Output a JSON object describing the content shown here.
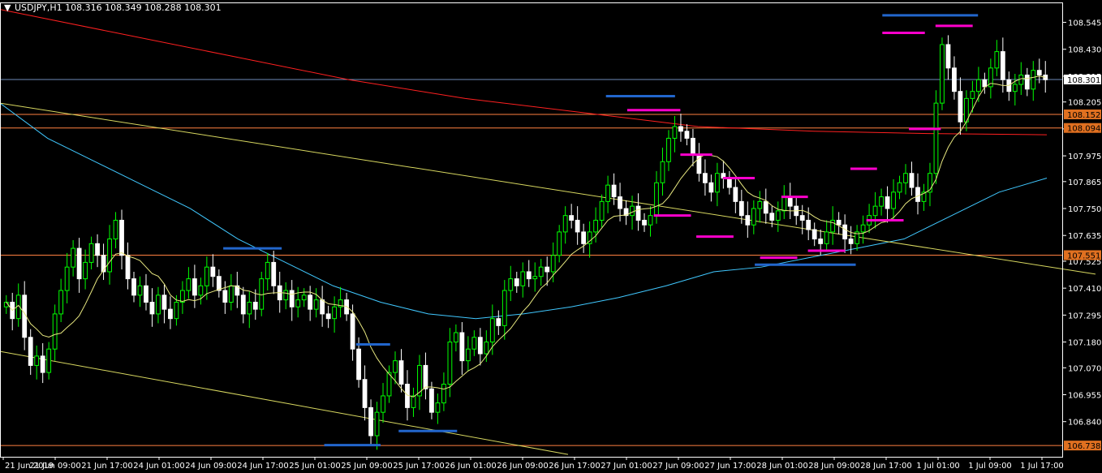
{
  "header": {
    "title": "USDJPY,H1  108.316 108.349 108.288 108.301",
    "menu_icon": "triangle-down-icon"
  },
  "colors": {
    "background": "#000000",
    "axis": "#ffffff",
    "bull": "#00ff00",
    "bear": "#ffffff",
    "ma_fast": "#e8e880",
    "ma_slow": "#40c8ff",
    "ma_long": "#ff2020",
    "trend": "#d8d860",
    "level": "#ff8040",
    "bid_line": "#6e8cb8",
    "resistance": "#ff00cc",
    "support": "#2266cc",
    "badge_orange": "#e07020"
  },
  "chart_data": {
    "type": "candlestick",
    "symbol": "USDJPY",
    "timeframe": "H1",
    "ohlc_summary": {
      "open": 108.316,
      "high": 108.349,
      "low": 108.288,
      "close": 108.301
    },
    "ylim": [
      106.69,
      108.63
    ],
    "y_ticks": [
      "108.545",
      "108.430",
      "108.315",
      "108.205",
      "108.090",
      "107.975",
      "107.865",
      "107.750",
      "107.635",
      "107.525",
      "107.410",
      "107.295",
      "107.180",
      "107.070",
      "106.955",
      "106.840"
    ],
    "x_ticks": [
      "21 Jun 2019",
      "21 Jun 09:00",
      "21 Jun 17:00",
      "24 Jun 01:00",
      "24 Jun 09:00",
      "24 Jun 17:00",
      "25 Jun 01:00",
      "25 Jun 09:00",
      "25 Jun 17:00",
      "26 Jun 01:00",
      "26 Jun 09:00",
      "26 Jun 17:00",
      "27 Jun 01:00",
      "27 Jun 09:00",
      "27 Jun 17:00",
      "28 Jun 01:00",
      "28 Jun 09:00",
      "28 Jun 17:00",
      "1 Jul 01:00",
      "1 Jul 09:00",
      "1 Jul 17:00"
    ],
    "price_badges": [
      {
        "value": 108.301,
        "label": "108.301",
        "style": "bid"
      },
      {
        "value": 108.152,
        "label": "108.152",
        "style": "level"
      },
      {
        "value": 108.094,
        "label": "108.094",
        "style": "level"
      },
      {
        "value": 107.551,
        "label": "107.551",
        "style": "level"
      },
      {
        "value": 106.738,
        "label": "106.738",
        "style": "level"
      }
    ],
    "horizontal_levels": [
      108.152,
      108.094,
      107.551,
      106.738
    ],
    "bid_line": 108.301,
    "closes": [
      107.35,
      107.28,
      107.38,
      107.2,
      107.08,
      107.12,
      107.05,
      107.15,
      107.3,
      107.4,
      107.5,
      107.58,
      107.45,
      107.52,
      107.6,
      107.55,
      107.48,
      107.62,
      107.7,
      107.55,
      107.45,
      107.38,
      107.42,
      107.35,
      107.3,
      107.38,
      107.32,
      107.28,
      107.35,
      107.4,
      107.45,
      107.38,
      107.42,
      107.5,
      107.46,
      107.4,
      107.35,
      107.42,
      107.38,
      107.3,
      107.35,
      107.32,
      107.45,
      107.52,
      107.42,
      107.36,
      107.4,
      107.33,
      107.36,
      107.38,
      107.32,
      107.36,
      107.3,
      107.28,
      107.33,
      107.36,
      107.3,
      107.15,
      107.02,
      106.9,
      106.78,
      106.88,
      106.95,
      107.05,
      107.1,
      107.0,
      106.9,
      106.95,
      107.08,
      106.98,
      106.88,
      106.92,
      107.0,
      107.18,
      107.22,
      107.1,
      107.15,
      107.2,
      107.13,
      107.18,
      107.28,
      107.25,
      107.4,
      107.45,
      107.42,
      107.48,
      107.45,
      107.46,
      107.5,
      107.48,
      107.55,
      107.65,
      107.72,
      107.7,
      107.65,
      107.6,
      107.65,
      107.7,
      107.78,
      107.85,
      107.8,
      107.75,
      107.72,
      107.76,
      107.7,
      107.68,
      107.72,
      107.86,
      107.95,
      108.05,
      108.1,
      108.08,
      108.05,
      107.98,
      107.9,
      107.86,
      107.82,
      107.9,
      107.88,
      107.84,
      107.78,
      107.72,
      107.68,
      107.75,
      107.78,
      107.73,
      107.7,
      107.74,
      107.8,
      107.76,
      107.72,
      107.7,
      107.66,
      107.62,
      107.6,
      107.65,
      107.7,
      107.68,
      107.62,
      107.6,
      107.65,
      107.68,
      107.72,
      107.76,
      107.8,
      107.75,
      107.82,
      107.86,
      107.9,
      107.84,
      107.78,
      107.82,
      107.9,
      108.2,
      108.45,
      108.35,
      108.25,
      108.12,
      108.22,
      108.25,
      108.3,
      108.27,
      108.35,
      108.42,
      108.3,
      108.25,
      108.28,
      108.32,
      108.26,
      108.34,
      108.32,
      108.3
    ],
    "ma_fast_points": [
      [
        107.52,
        107.45,
        107.32,
        107.32,
        107.38,
        107.42,
        107.44,
        107.44,
        107.42,
        107.43,
        107.42,
        107.4,
        107.28,
        107.08,
        107.02,
        107.08,
        107.18,
        107.38,
        107.58,
        107.72,
        107.78,
        107.86,
        107.88,
        107.82,
        107.8,
        107.74,
        107.7,
        107.72,
        107.78,
        107.98,
        108.1,
        108.26
      ]
    ],
    "ma_slow_points": [
      108.2,
      108.05,
      107.95,
      107.85,
      107.75,
      107.62,
      107.52,
      107.42,
      107.35,
      107.3,
      107.28,
      107.3,
      107.33,
      107.37,
      107.42,
      107.48,
      107.5,
      107.54,
      107.58,
      107.62,
      107.72,
      107.82,
      107.88
    ],
    "ma_long_points": [
      108.6,
      108.5,
      108.4,
      108.3,
      108.22,
      108.16,
      108.1,
      108.08,
      108.07,
      108.065
    ],
    "trend_upper": [
      [
        108.2
      ],
      [
        107.47
      ]
    ],
    "trend_lower": [
      [
        107.14
      ],
      [
        106.7
      ]
    ],
    "resistance_marks": [
      {
        "value": 108.17,
        "x_from": 0.59,
        "x_to": 0.64
      },
      {
        "value": 107.98,
        "x_from": 0.64,
        "x_to": 0.67
      },
      {
        "value": 107.88,
        "x_from": 0.68,
        "x_to": 0.71
      },
      {
        "value": 107.8,
        "x_from": 0.735,
        "x_to": 0.76
      },
      {
        "value": 107.92,
        "x_from": 0.8,
        "x_to": 0.825
      },
      {
        "value": 107.7,
        "x_from": 0.815,
        "x_to": 0.85
      },
      {
        "value": 108.5,
        "x_from": 0.83,
        "x_to": 0.87
      },
      {
        "value": 108.53,
        "x_from": 0.88,
        "x_to": 0.915
      },
      {
        "value": 108.09,
        "x_from": 0.855,
        "x_to": 0.885
      },
      {
        "value": 107.72,
        "x_from": 0.615,
        "x_to": 0.65
      },
      {
        "value": 107.63,
        "x_from": 0.655,
        "x_to": 0.69
      },
      {
        "value": 107.54,
        "x_from": 0.715,
        "x_to": 0.75
      },
      {
        "value": 107.57,
        "x_from": 0.76,
        "x_to": 0.795
      }
    ],
    "support_marks": [
      {
        "value": 108.575,
        "x_from": 0.83,
        "x_to": 0.92
      },
      {
        "value": 108.23,
        "x_from": 0.57,
        "x_to": 0.635
      },
      {
        "value": 107.58,
        "x_from": 0.21,
        "x_to": 0.265
      },
      {
        "value": 107.17,
        "x_from": 0.335,
        "x_to": 0.367
      },
      {
        "value": 106.8,
        "x_from": 0.375,
        "x_to": 0.43
      },
      {
        "value": 106.74,
        "x_from": 0.305,
        "x_to": 0.358
      },
      {
        "value": 107.51,
        "x_from": 0.71,
        "x_to": 0.805
      }
    ]
  }
}
